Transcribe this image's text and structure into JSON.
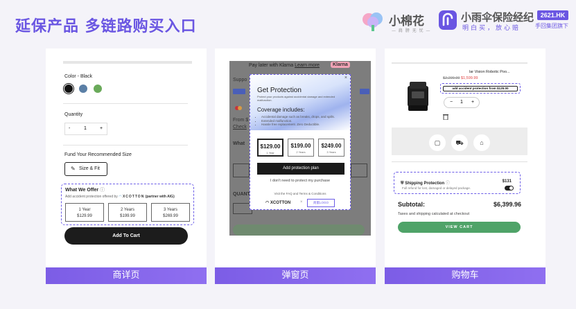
{
  "header": {
    "title": "延保产品 多链路购买入口",
    "brand1_name": "小棉花",
    "brand1_slogan": "— 肩 膀 无 忧 —",
    "brand2_name": "小雨伞保险经纪",
    "brand2_slogan": "明白买，放心赔",
    "hk_badge": "2621.HK",
    "hk_sub": "手回集团旗下"
  },
  "colors": {
    "accent": "#6a56e2",
    "caption_bar": "#7c5de6",
    "view_cart": "#4fa368"
  },
  "panel1": {
    "caption": "商详页",
    "color_label": "Color - Black",
    "swatches": [
      "#111111",
      "#5b7fa6",
      "#6aaa5a"
    ],
    "quantity_label": "Quantity",
    "qty_minus": "-",
    "qty_value": "1",
    "qty_plus": "+",
    "fit_label": "Fund Your Recommended Size",
    "size_fit_button": "Size & Fit",
    "size_fit_icon": "ruler-icon",
    "offer_title": "What We Offer",
    "offer_info_icon": "ⓘ",
    "offer_sub": "Add accident protection offered by",
    "offer_brand": "XCOTTON",
    "offer_partner": "(partner with AIG)",
    "plans": [
      {
        "term": "1 Year",
        "price": "$129.99"
      },
      {
        "term": "2 Years",
        "price": "$199.99"
      },
      {
        "term": "3 Years",
        "price": "$269.99"
      }
    ],
    "add_to_cart": "Add To Cart"
  },
  "panel2": {
    "caption": "弹窗页",
    "bg_klarna": "Pay later with Klarna",
    "bg_learn_more": "Learn more",
    "bg_klarna_badge": "Klarna",
    "bg_support": "Suppo",
    "bg_from": "From $",
    "bg_check": "Check",
    "bg_what": "What",
    "bg_quant": "QUANT",
    "close": "×",
    "title": "Get Protection",
    "desc": "Protect your products against accidental damage and extended malfunction.",
    "coverage_title": "Coverage includes:",
    "coverage": [
      "Accidental damage such as breaks, drops, and spills.",
      "Extended malfunction.",
      "Hassle free replacement. Zero Deductible."
    ],
    "plans": [
      {
        "price": "$129.00",
        "term": "1 Year"
      },
      {
        "price": "$199.00",
        "term": "2 Years"
      },
      {
        "price": "$249.00",
        "term": "3 Years"
      }
    ],
    "add_plan": "Add protection plan",
    "no_protect": "I don't need to protect my purchase",
    "faq_text": "Visit the FAQ and Terms & Conditions",
    "xcotton": "XCOTTON",
    "shop_logo": "商家LOGO"
  },
  "panel3": {
    "caption": "购物车",
    "product_title": "lar Vision Robotic Poo...",
    "price_old": "$2,299.99",
    "price_new": "$1,599.99",
    "add_accident": "add accident protection from $125.00",
    "qty_minus": "−",
    "qty_value": "1",
    "qty_plus": "+",
    "trash_icon": "trash-icon",
    "shipping_title": "Shipping Protection",
    "shipping_sub": "Full refund for lost, damaged or delayed package.",
    "shipping_price": "$131",
    "subtotal_label": "Subtotal:",
    "subtotal_value": "$6,399.96",
    "taxes_text": "Taxes and shipping calculated at checkout",
    "view_cart": "VIEW CART"
  }
}
